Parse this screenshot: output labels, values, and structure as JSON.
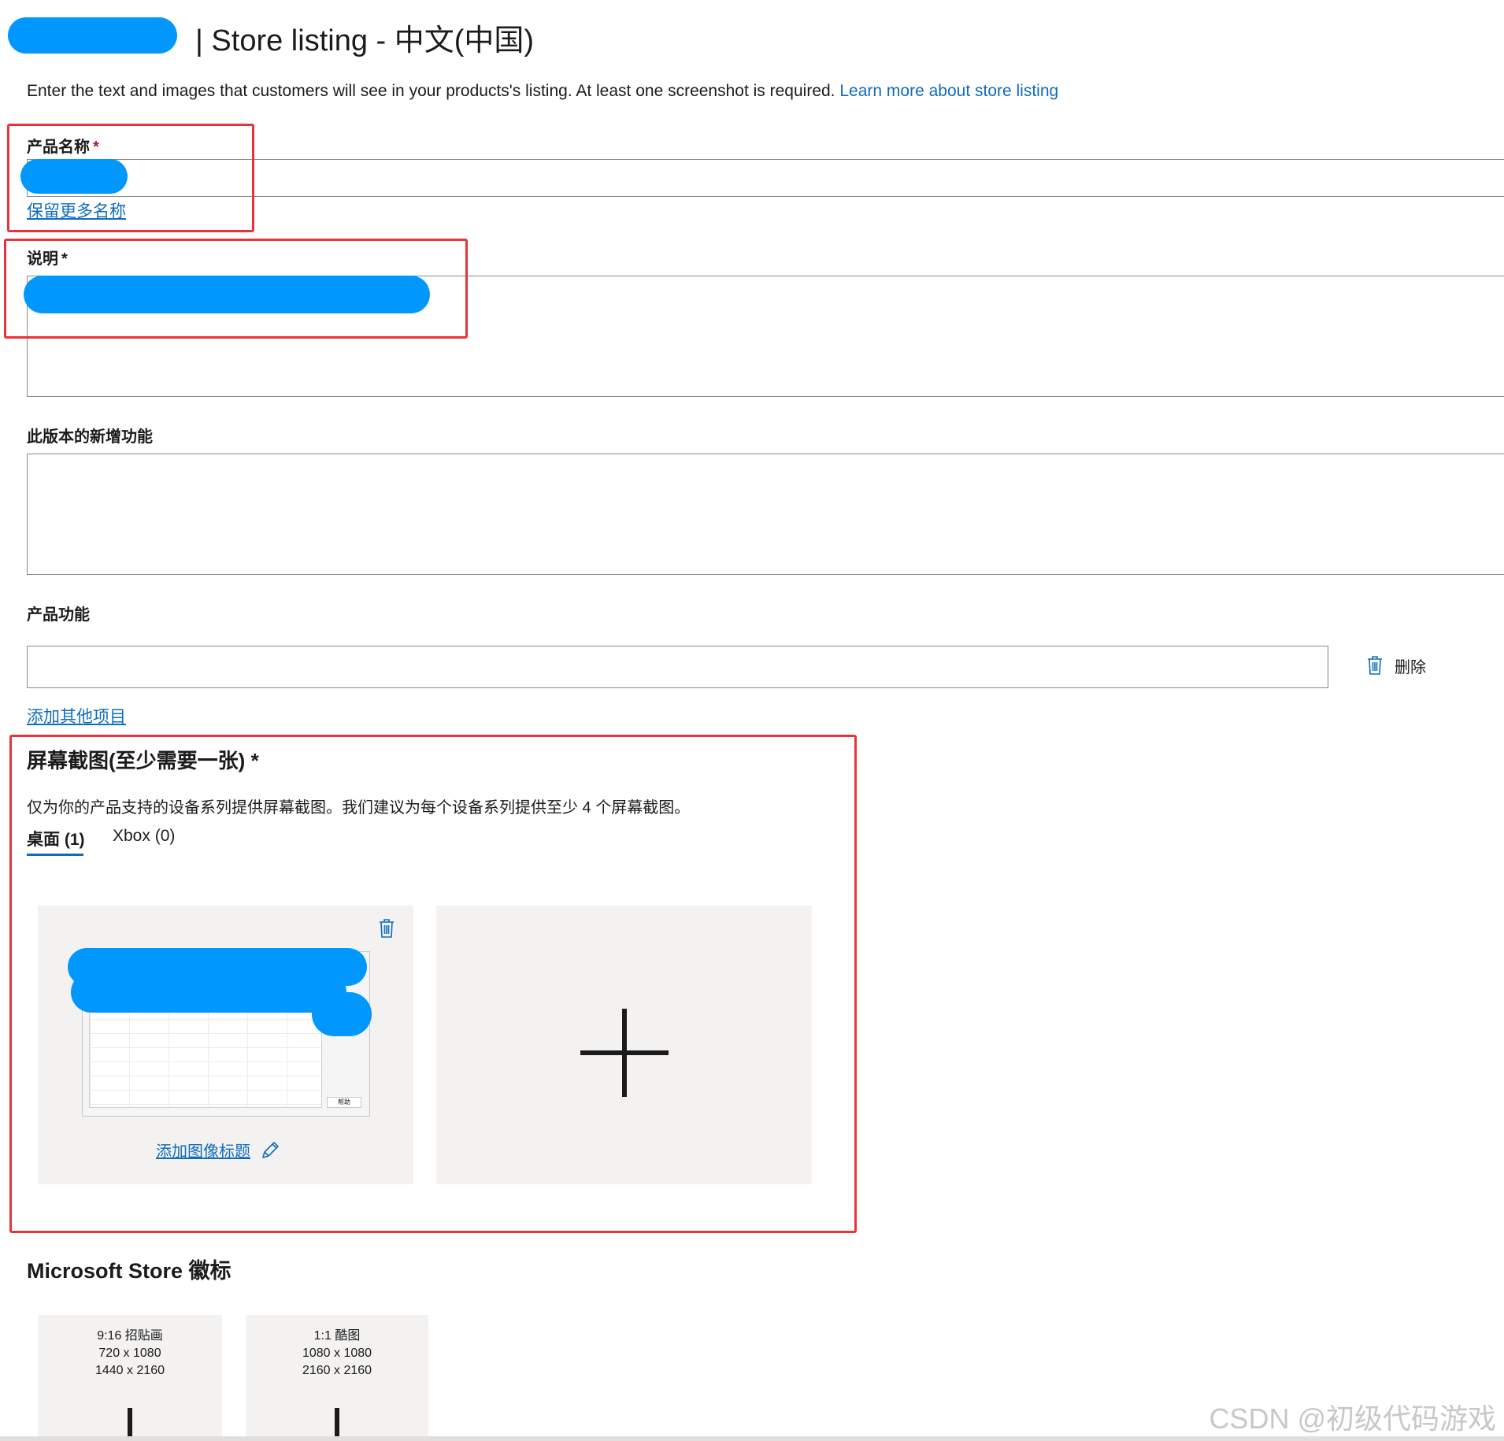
{
  "header": {
    "title": "| Store listing - 中文(中国)"
  },
  "intro": {
    "text": "Enter the text and images that customers will see in your products's listing. At least one screenshot is required.",
    "link": "Learn more about store listing"
  },
  "product_name": {
    "label": "产品名称",
    "required_mark": "*",
    "reserve_link": "保留更多名称"
  },
  "description": {
    "label": "说明",
    "required_mark": "*"
  },
  "whats_new": {
    "label": "此版本的新增功能"
  },
  "features": {
    "label": "产品功能",
    "delete_label": "删除",
    "add_link": "添加其他项目"
  },
  "screenshots": {
    "heading": "屏幕截图(至少需要一张)",
    "required_mark": "*",
    "hint": "仅为你的产品支持的设备系列提供屏幕截图。我们建议为每个设备系列提供至少 4 个屏幕截图。",
    "tabs": [
      {
        "label": "桌面 (1)",
        "active": true
      },
      {
        "label": "Xbox (0)",
        "active": false
      }
    ],
    "thumb_button": "帮助",
    "caption_link": "添加图像标题"
  },
  "store_logos": {
    "heading": "Microsoft Store 徽标",
    "tiles": [
      {
        "title": "9:16 招贴画",
        "size1": "720 x 1080",
        "size2": "1440 x 2160"
      },
      {
        "title": "1:1 酷图",
        "size1": "1080 x 1080",
        "size2": "2160 x 2160"
      }
    ]
  },
  "watermark": "CSDN @初级代码游戏",
  "colors": {
    "link": "#0f6cbd",
    "annotation_red": "#e8333a",
    "redaction_blue": "#0098ff",
    "tile_bg": "#f3f2f1"
  }
}
